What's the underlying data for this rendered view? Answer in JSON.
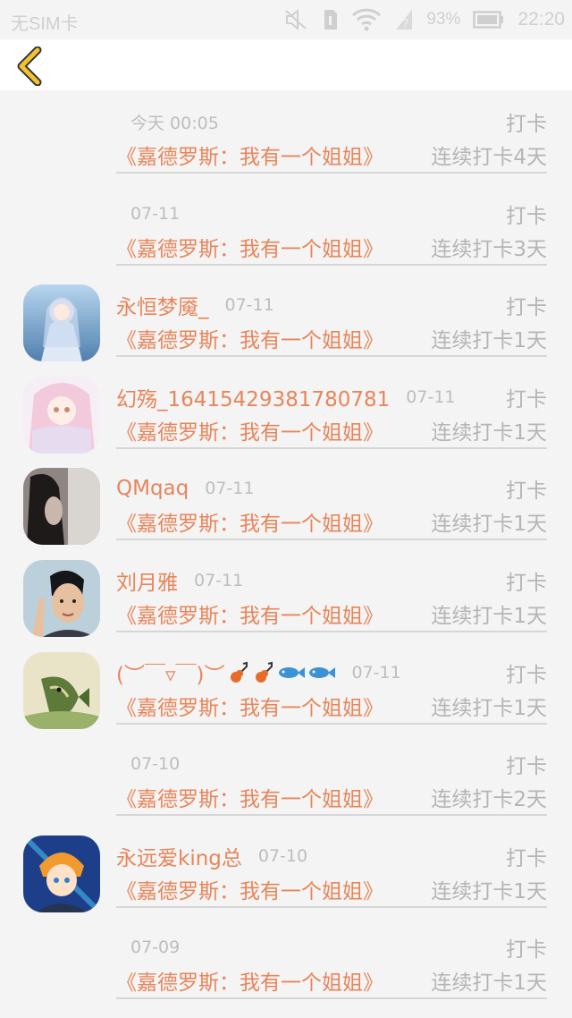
{
  "status_bar": {
    "carrier": "无SIM卡",
    "battery": "93%",
    "time": "22:20",
    "icons": [
      "mute-icon",
      "sim-icon",
      "wifi-icon",
      "no-signal-icon",
      "battery-icon"
    ]
  },
  "nav": {
    "back_icon": "chevron-left-icon",
    "accent": "#f2c230"
  },
  "colors": {
    "accent": "#e8855a",
    "muted": "#b5b5b5"
  },
  "rows": [
    {
      "username": "",
      "date": "今天 00:05",
      "action": "打卡",
      "book": "《嘉德罗斯：我有一个姐姐》",
      "streak": "连续打卡4天",
      "avatar": ""
    },
    {
      "username": "",
      "date": "07-11",
      "action": "打卡",
      "book": "《嘉德罗斯：我有一个姐姐》",
      "streak": "连续打卡3天",
      "avatar": ""
    },
    {
      "username": "永恒梦魇_",
      "date": "07-11",
      "action": "打卡",
      "book": "《嘉德罗斯：我有一个姐姐》",
      "streak": "连续打卡1天",
      "avatar": "anime-girl-blue"
    },
    {
      "username": "幻殇_1641542938178078​1",
      "date": "07-11",
      "action": "打卡",
      "book": "《嘉德罗斯：我有一个姐姐》",
      "streak": "连续打卡1天",
      "avatar": "anime-girl-pink"
    },
    {
      "username": "QMqaq",
      "date": "07-11",
      "action": "打卡",
      "book": "《嘉德罗斯：我有一个姐姐》",
      "streak": "连续打卡1天",
      "avatar": "dark-photo"
    },
    {
      "username": "刘月雅",
      "date": "07-11",
      "action": "打卡",
      "book": "《嘉德罗斯：我有一个姐姐》",
      "streak": "连续打卡1天",
      "avatar": "boy-photo"
    },
    {
      "username": "(︶￣▿￣)︶",
      "date": "07-11",
      "action": "打卡",
      "book": "《嘉德罗斯：我有一个姐姐》",
      "streak": "连续打卡1天",
      "avatar": "fish-photo"
    },
    {
      "username": "",
      "date": "07-10",
      "action": "打卡",
      "book": "《嘉德罗斯：我有一个姐姐》",
      "streak": "连续打卡2天",
      "avatar": ""
    },
    {
      "username": "永远爱king总",
      "date": "07-10",
      "action": "打卡",
      "book": "《嘉德罗斯：我有一个姐姐》",
      "streak": "连续打卡1天",
      "avatar": "anime-boy-orange"
    },
    {
      "username": "",
      "date": "07-09",
      "action": "打卡",
      "book": "《嘉德罗斯：我有一个姐姐》",
      "streak": "连续打卡1天",
      "avatar": ""
    }
  ]
}
